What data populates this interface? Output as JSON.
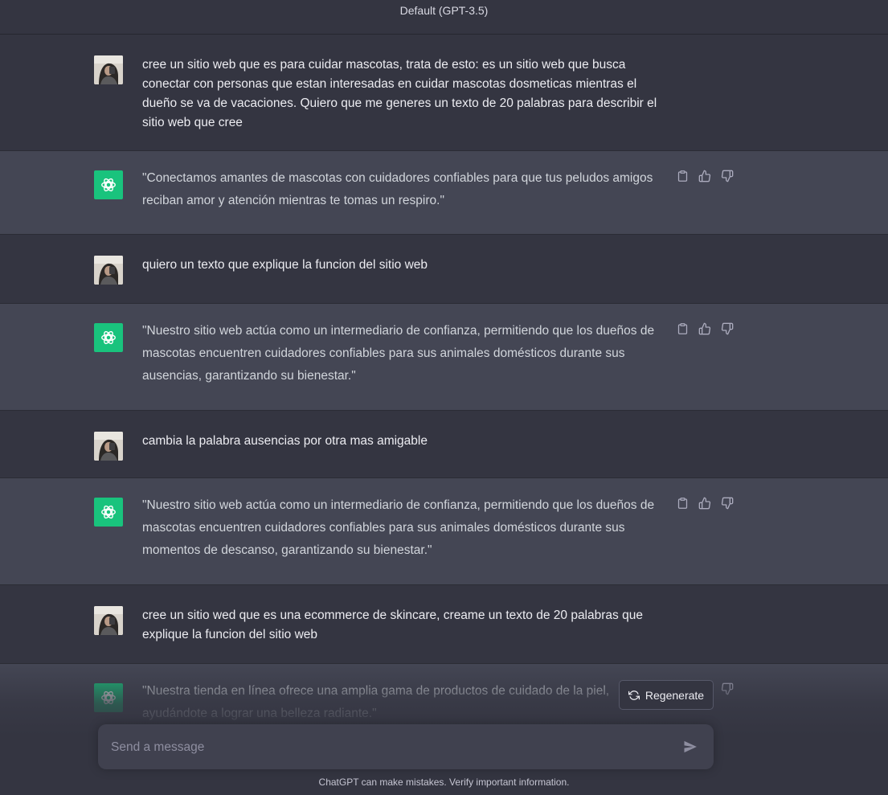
{
  "header": {
    "model_label": "Default (GPT-3.5)"
  },
  "messages": [
    {
      "role": "user",
      "text": "cree un sitio web que es para cuidar mascotas, trata de esto: es un sitio web que busca conectar con personas que estan interesadas en cuidar mascotas dosmeticas mientras el dueño se va de vacaciones. Quiero que me generes un texto de 20 palabras para describir el sitio web que cree"
    },
    {
      "role": "assistant",
      "text": "\"Conectamos amantes de mascotas con cuidadores confiables para que tus peludos amigos reciban amor y atención mientras te tomas un respiro.\""
    },
    {
      "role": "user",
      "text": "quiero un texto que explique la funcion del sitio web"
    },
    {
      "role": "assistant",
      "text": "\"Nuestro sitio web actúa como un intermediario de confianza, permitiendo que los dueños de mascotas encuentren cuidadores confiables para sus animales domésticos durante sus ausencias, garantizando su bienestar.\""
    },
    {
      "role": "user",
      "text": "cambia la palabra ausencias por otra mas amigable"
    },
    {
      "role": "assistant",
      "text": "\"Nuestro sitio web actúa como un intermediario de confianza, permitiendo que los dueños de mascotas encuentren cuidadores confiables para sus animales domésticos durante sus momentos de descanso, garantizando su bienestar.\""
    },
    {
      "role": "user",
      "text": "cree un sitio wed que es una ecommerce de skincare, creame un texto de 20 palabras que explique la funcion del sitio web"
    },
    {
      "role": "assistant",
      "text": "\"Nuestra tienda en línea ofrece una amplia gama de productos de cuidado de la piel, ayudándote a lograr una belleza radiante.\""
    }
  ],
  "actions": {
    "icons": [
      "clipboard-icon",
      "thumbs-up-icon",
      "thumbs-down-icon"
    ]
  },
  "regenerate": {
    "label": "Regenerate"
  },
  "composer": {
    "placeholder": "Send a message"
  },
  "footer": {
    "disclaimer": "ChatGPT can make mistakes. Verify important information."
  },
  "colors": {
    "accent": "#19c37d",
    "background": "#343541",
    "assistant_row": "#444654",
    "composer": "#40414f"
  }
}
